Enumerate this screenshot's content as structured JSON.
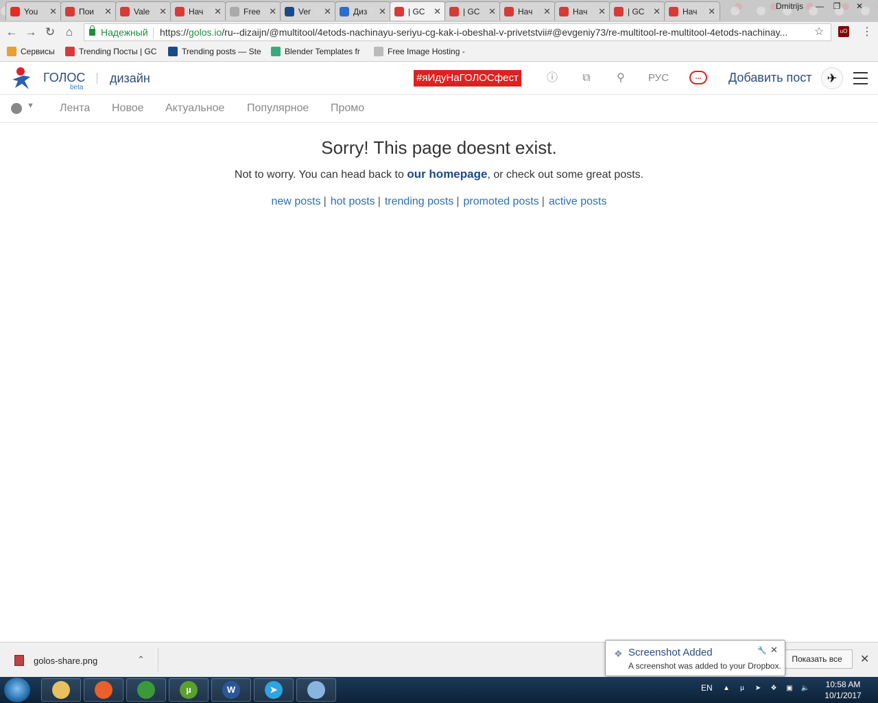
{
  "browser": {
    "tabs": [
      {
        "title": "You",
        "fav_color": "#e52d27"
      },
      {
        "title": "Пои",
        "fav_color": "#d83a3a"
      },
      {
        "title": "Vale",
        "fav_color": "#d83a3a"
      },
      {
        "title": "Нач",
        "fav_color": "#d83a3a"
      },
      {
        "title": "Free",
        "fav_color": "#aaaaaa"
      },
      {
        "title": "Ver",
        "fav_color": "#1a4a8a"
      },
      {
        "title": "Диз",
        "fav_color": "#2a6fd0"
      },
      {
        "title": "| GC",
        "fav_color": "#d83a3a"
      },
      {
        "title": "| GC",
        "fav_color": "#d83a3a"
      },
      {
        "title": "Нач",
        "fav_color": "#d83a3a"
      },
      {
        "title": "Нач",
        "fav_color": "#d83a3a"
      },
      {
        "title": "| GC",
        "fav_color": "#d83a3a"
      },
      {
        "title": "Нач",
        "fav_color": "#d83a3a"
      }
    ],
    "active_tab_index": 7,
    "user": "Dmitrijs",
    "secure_label": "Надежный",
    "url_scheme": "https://",
    "url_host": "golos.io",
    "url_path": "/ru--dizaijn/@multitool/4etods-nachinayu-seriyu-cg-kak-i-obeshal-v-privetstvii#@evgeniy73/re-multitool-re-multitool-4etods-nachinay...",
    "bookmarks": [
      {
        "label": "Сервисы",
        "icon_color": "#e8a030"
      },
      {
        "label": "Trending Посты | GC",
        "icon_color": "#d83a3a"
      },
      {
        "label": "Trending posts — Ste",
        "icon_color": "#1a4a8a"
      },
      {
        "label": "Blender Templates fr",
        "icon_color": "#3aaa7a"
      },
      {
        "label": "Free Image Hosting -",
        "icon_color": "#bbbbbb"
      }
    ]
  },
  "header": {
    "brand": "ГОЛОС",
    "beta": "beta",
    "section": "дизайн",
    "fest_tag": "#яИдуНаГОЛОСфест",
    "lang": "РУС",
    "chat_glyph": "...",
    "add_post": "Добавить пост"
  },
  "subnav": {
    "items": [
      "Лента",
      "Новое",
      "Актуальное",
      "Популярное",
      "Промо"
    ]
  },
  "main": {
    "title": "Sorry! This page doesnt exist.",
    "text_before": "Not to worry. You can head back to ",
    "homepage_link": "our homepage",
    "text_after": ", or check out some great posts.",
    "links": [
      "new posts",
      "hot posts",
      "trending posts",
      "promoted posts",
      "active posts"
    ],
    "link_separator": "|"
  },
  "download_bar": {
    "file_name": "golos-share.png",
    "show_all": "Показать все"
  },
  "notification": {
    "title": "Screenshot Added",
    "body": "A screenshot was added to your Dropbox."
  },
  "taskbar": {
    "apps": [
      {
        "name": "explorer",
        "glyph": "",
        "color": "#e8c060"
      },
      {
        "name": "firefox",
        "glyph": "",
        "color": "#e8602a"
      },
      {
        "name": "chrome",
        "glyph": "",
        "color": "#3a9a3a"
      },
      {
        "name": "utorrent",
        "glyph": "µ",
        "color": "#5aa02c"
      },
      {
        "name": "word",
        "glyph": "W",
        "color": "#2b5797"
      },
      {
        "name": "telegram",
        "glyph": "➤",
        "color": "#2ca5e0"
      },
      {
        "name": "paint",
        "glyph": "",
        "color": "#8ab4e0"
      }
    ],
    "lang": "EN",
    "time": "10:58 AM",
    "date": "10/1/2017"
  },
  "colors": {
    "brand_blue": "#2c4c7c",
    "fest_red": "#e02020",
    "link_blue": "#2c6fb0",
    "secure_green": "#1e8e3e"
  }
}
